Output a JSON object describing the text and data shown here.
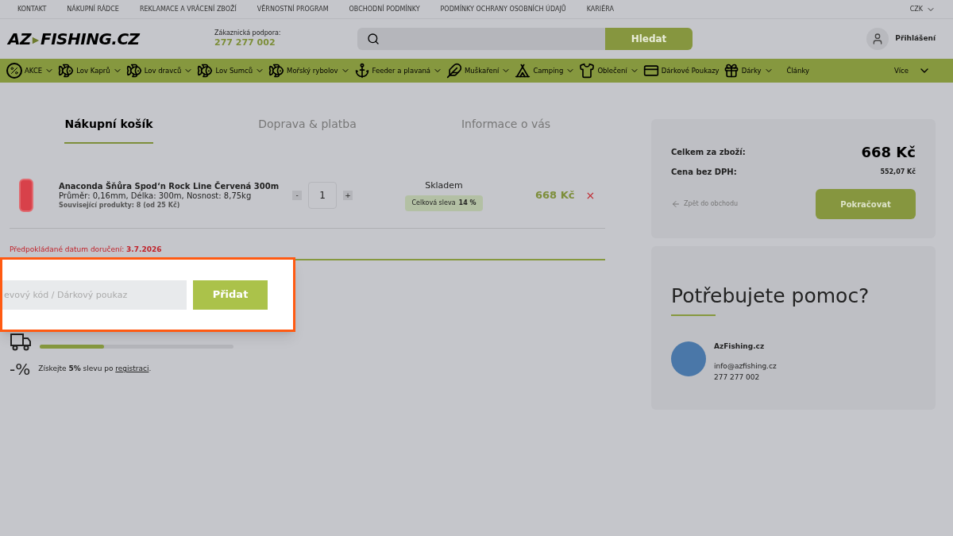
{
  "top_links": [
    "KONTAKT",
    "NÁKUPNÍ RÁDCE",
    "REKLAMACE A VRÁCENÍ ZBOŽÍ",
    "VĚRNOSTNÍ PROGRAM",
    "OBCHODNÍ PODMÍNKY",
    "PODMÍNKY OCHRANY OSOBNÍCH ÚDAJŮ",
    "KARIÉRA"
  ],
  "currency": "CZK",
  "logo": {
    "left": "AZ",
    "right": "FISHING.CZ"
  },
  "support": {
    "label": "Zákaznická podpora:",
    "phone": "277 277 002"
  },
  "search": {
    "button": "Hledat"
  },
  "login": "Přihlášení",
  "nav": [
    {
      "kind": "percent",
      "label": "AKCE",
      "dropdown": true
    },
    {
      "kind": "fish",
      "label": "Lov Kaprů",
      "dropdown": true
    },
    {
      "kind": "fish",
      "label": "Lov dravců",
      "dropdown": true
    },
    {
      "kind": "fish",
      "label": "Lov Sumců",
      "dropdown": true
    },
    {
      "kind": "fish",
      "label": "Mořský rybolov",
      "dropdown": true
    },
    {
      "kind": "feeder",
      "label": "Feeder a plavaná",
      "dropdown": true
    },
    {
      "kind": "fly",
      "label": "Muškaření",
      "dropdown": true
    },
    {
      "kind": "tent",
      "label": "Camping",
      "dropdown": true
    },
    {
      "kind": "vest",
      "label": "Oblečení",
      "dropdown": true
    },
    {
      "kind": "card",
      "label": "Dárkové Poukazy",
      "dropdown": false
    },
    {
      "kind": "gift",
      "label": "Dárky",
      "dropdown": true
    },
    {
      "kind": "none",
      "label": "Články",
      "dropdown": false
    }
  ],
  "more": "Více",
  "steps": [
    {
      "label": "Nákupní košík",
      "selected": true
    },
    {
      "label": "Doprava & platba",
      "selected": false
    },
    {
      "label": "Informace o vás",
      "selected": false
    }
  ],
  "item": {
    "name": "Anaconda Šňůra Spod‘n Rock Line Červená 300m",
    "params": "Průměr: 0,16mm, Délka: 300m, Nosnost: 8,75kg",
    "related": "Související produkty: 8 (od 25 Kč)",
    "minus": "-",
    "qty": "1",
    "plus": "+",
    "stock": "Skladem",
    "discount_label": "Celková sleva",
    "discount": "14 %",
    "price": "668 Kč",
    "remove": "×"
  },
  "delivery": "Předpokládané datum doručení: **3.7.2026**",
  "coupon": {
    "placeholder": "evový kód / Dárkový poukaz",
    "button": "Přidat"
  },
  "shipping": {
    "level": 0.33
  },
  "registration": {
    "icon": "-%",
    "before": "Získejte **5%** slevu po ",
    "link": "registraci",
    "after": "."
  },
  "summary": {
    "total_label": "Celkem za zboží:",
    "total": "668 Kč",
    "net_label": "Cena bez DPH:",
    "net": "552,07 Kč",
    "back": "Zpět do obchodu",
    "continue": "Pokračovat"
  },
  "help": {
    "title": "Potřebujete pomoc?",
    "name": "AzFishing.cz",
    "email": "info@azfishing.cz",
    "phone": "277 277 002"
  }
}
